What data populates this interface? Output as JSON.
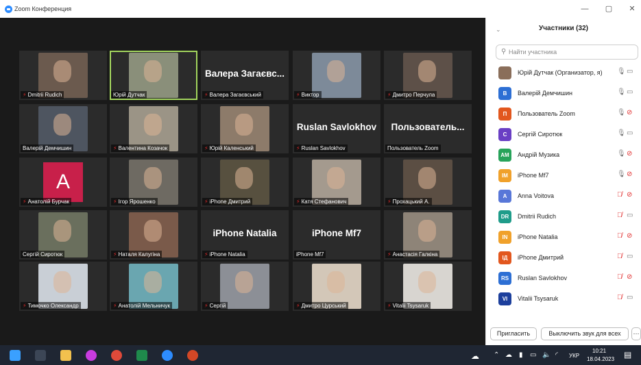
{
  "window": {
    "title": "Zoom Конференция",
    "min_label": "—",
    "max_label": "▢",
    "close_label": "✕"
  },
  "tiles": [
    {
      "label": "Dmitrii Rudich",
      "muted": true,
      "bg": "#6b5a4e"
    },
    {
      "label": "Юрій Дутчак",
      "muted": false,
      "bg": "#8a8f7a",
      "active": true
    },
    {
      "label": "Валера Загаєвський",
      "muted": true,
      "big": "Валера Загаєвс..."
    },
    {
      "label": "Виктор",
      "muted": true,
      "bg": "#7d8a99"
    },
    {
      "label": "Дмитро Перчула",
      "muted": true,
      "bg": "#5d5048"
    },
    {
      "label": "Валерій Демчишин",
      "muted": false,
      "bg": "#4e5560"
    },
    {
      "label": "Валентина Козачок",
      "muted": true,
      "bg": "#9b9486"
    },
    {
      "label": "Юрій Каленський",
      "muted": true,
      "bg": "#8d7b6a"
    },
    {
      "label": "Ruslan Savlokhov",
      "muted": true,
      "big": "Ruslan Savlokhov"
    },
    {
      "label": "Пользователь Zoom",
      "muted": false,
      "big": "Пользователь..."
    },
    {
      "label": "Анатолій Бурчак",
      "muted": true,
      "avatar": "A"
    },
    {
      "label": "Ігор Ярошенко",
      "muted": true,
      "bg": "#6e6a62"
    },
    {
      "label": "iPhone Дмитрий",
      "muted": true,
      "bg": "#57503f"
    },
    {
      "label": "Катя Стефанович",
      "muted": true,
      "bg": "#a49a8e"
    },
    {
      "label": "Прохацький А.",
      "muted": true,
      "bg": "#5b4e43"
    },
    {
      "label": "Сергій Сиротюк",
      "muted": false,
      "bg": "#6a6f5d"
    },
    {
      "label": "Наталя Калугіна",
      "muted": true,
      "bg": "#7a5a4a"
    },
    {
      "label": "iPhone Natalia",
      "muted": true,
      "big": "iPhone Natalia"
    },
    {
      "label": "iPhone Mf7",
      "muted": false,
      "big": "iPhone Mf7"
    },
    {
      "label": "Анастасія Галкіна",
      "muted": true,
      "bg": "#8e8478"
    },
    {
      "label": "Тимочко Олександр",
      "muted": true,
      "bg": "#c9cfd6"
    },
    {
      "label": "Анатолій Мельничук",
      "muted": true,
      "bg": "#6aa6b0"
    },
    {
      "label": "Сергій",
      "muted": true,
      "bg": "#8c8f96"
    },
    {
      "label": "Дмитро Цурський",
      "muted": true,
      "bg": "#d3c7b8"
    },
    {
      "label": "Vitalii Tsysaruk",
      "muted": true,
      "bg": "#d8d5d0"
    }
  ],
  "panel": {
    "title": "Участники (32)",
    "collapse_icon": "⌄",
    "search_placeholder": "Найти участника",
    "invite_label": "Пригласить",
    "mute_all_label": "Выключить звук для всех",
    "more_label": "···",
    "participants": [
      {
        "initials": "",
        "name": "Юрій Дутчак (Организатор, я)",
        "color": "#8a6e5a",
        "mic_muted": false,
        "cam_off": false
      },
      {
        "initials": "В",
        "name": "Валерій Демчишин",
        "color": "#2d6fd4",
        "mic_muted": false,
        "cam_off": false
      },
      {
        "initials": "П",
        "name": "Пользователь Zoom",
        "color": "#e2571e",
        "mic_muted": false,
        "cam_off": true
      },
      {
        "initials": "С",
        "name": "Сергій Сиротюк",
        "color": "#6a3fc4",
        "mic_muted": false,
        "cam_off": false
      },
      {
        "initials": "АМ",
        "name": "Андрій Музика",
        "color": "#27a35a",
        "mic_muted": false,
        "cam_off": true
      },
      {
        "initials": "IM",
        "name": "iPhone Mf7",
        "color": "#f0a12b",
        "mic_muted": false,
        "cam_off": true
      },
      {
        "initials": "A",
        "name": "Anna Voitova",
        "color": "#5877d8",
        "mic_muted": true,
        "cam_off": true
      },
      {
        "initials": "DR",
        "name": "Dmitrii Rudich",
        "color": "#1f9c8a",
        "mic_muted": true,
        "cam_off": false
      },
      {
        "initials": "IN",
        "name": "iPhone Natalia",
        "color": "#f0a12b",
        "mic_muted": true,
        "cam_off": true
      },
      {
        "initials": "IД",
        "name": "iPhone Дмитрий",
        "color": "#e2571e",
        "mic_muted": true,
        "cam_off": false
      },
      {
        "initials": "RS",
        "name": "Ruslan Savlokhov",
        "color": "#2d6fd4",
        "mic_muted": true,
        "cam_off": true
      },
      {
        "initials": "VI",
        "name": "Vitalii Tsysaruk",
        "color": "#1c3f9c",
        "mic_muted": true,
        "cam_off": false
      }
    ]
  },
  "taskbar": {
    "apps": [
      {
        "name": "windows-start-icon",
        "color": "#3aa0ff"
      },
      {
        "name": "search-icon",
        "color": "#3c4656"
      },
      {
        "name": "file-explorer-icon",
        "color": "#f2c14e"
      },
      {
        "name": "messenger-icon",
        "color": "#c83ce0"
      },
      {
        "name": "chrome-icon",
        "color": "#e04a3a"
      },
      {
        "name": "excel-icon",
        "color": "#1f8a4c"
      },
      {
        "name": "zoom-icon",
        "color": "#2d8cff"
      },
      {
        "name": "powerpoint-icon",
        "color": "#d24726"
      }
    ],
    "lang": "УКР",
    "time": "10:21",
    "date": "18.04.2023"
  }
}
